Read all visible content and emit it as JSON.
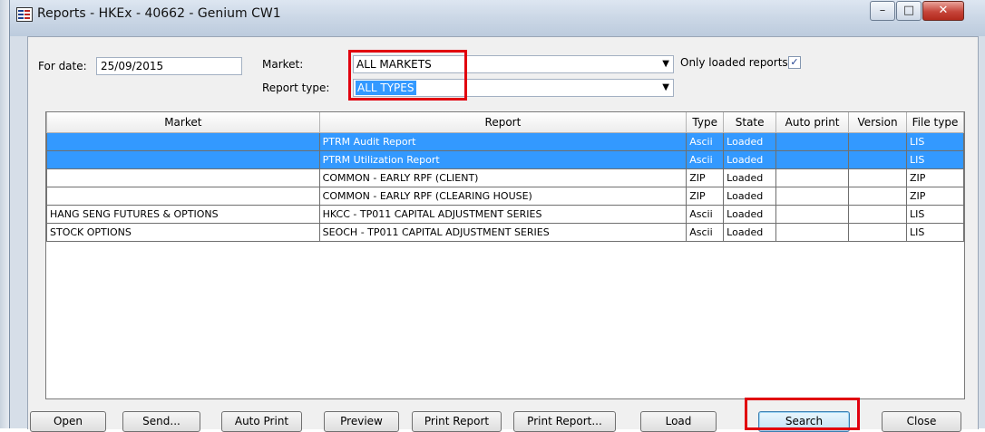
{
  "window": {
    "title": "Reports - HKEx - 40662 - Genium CW1",
    "minimize": "–",
    "maximize": "□",
    "close": "✕"
  },
  "filters": {
    "date_label": "For date:",
    "date_value": "25/09/2015",
    "market_label": "Market:",
    "market_value": "ALL MARKETS",
    "report_type_label": "Report type:",
    "report_type_value": "ALL TYPES",
    "only_loaded_label": "Only loaded reports",
    "only_loaded_checked": "✓"
  },
  "table": {
    "columns": [
      "Market",
      "Report",
      "Type",
      "State",
      "Auto print",
      "Version",
      "File type"
    ],
    "rows": [
      [
        "",
        "PTRM Audit Report",
        "Ascii",
        "Loaded",
        "",
        "",
        "LIS"
      ],
      [
        "",
        "PTRM Utilization Report",
        "Ascii",
        "Loaded",
        "",
        "",
        "LIS"
      ],
      [
        "",
        "COMMON - EARLY RPF (CLIENT)",
        "ZIP",
        "Loaded",
        "",
        "",
        "ZIP"
      ],
      [
        "",
        "COMMON - EARLY RPF (CLEARING HOUSE)",
        "ZIP",
        "Loaded",
        "",
        "",
        "ZIP"
      ],
      [
        "HANG SENG FUTURES & OPTIONS",
        "HKCC - TP011 CAPITAL ADJUSTMENT SERIES",
        "Ascii",
        "Loaded",
        "",
        "",
        "LIS"
      ],
      [
        "STOCK OPTIONS",
        "SEOCH - TP011 CAPITAL ADJUSTMENT SERIES",
        "Ascii",
        "Loaded",
        "",
        "",
        "LIS"
      ]
    ]
  },
  "buttons": {
    "open": "Open",
    "send": "Send...",
    "auto_print": "Auto Print",
    "preview": "Preview",
    "print_report": "Print Report",
    "print_report_dialog": "Print Report...",
    "load": "Load",
    "search": "Search",
    "close": "Close"
  },
  "colors": {
    "selection": "#3399ff",
    "highlight_box": "#e1000e",
    "window_frame": "#d6dee8"
  }
}
